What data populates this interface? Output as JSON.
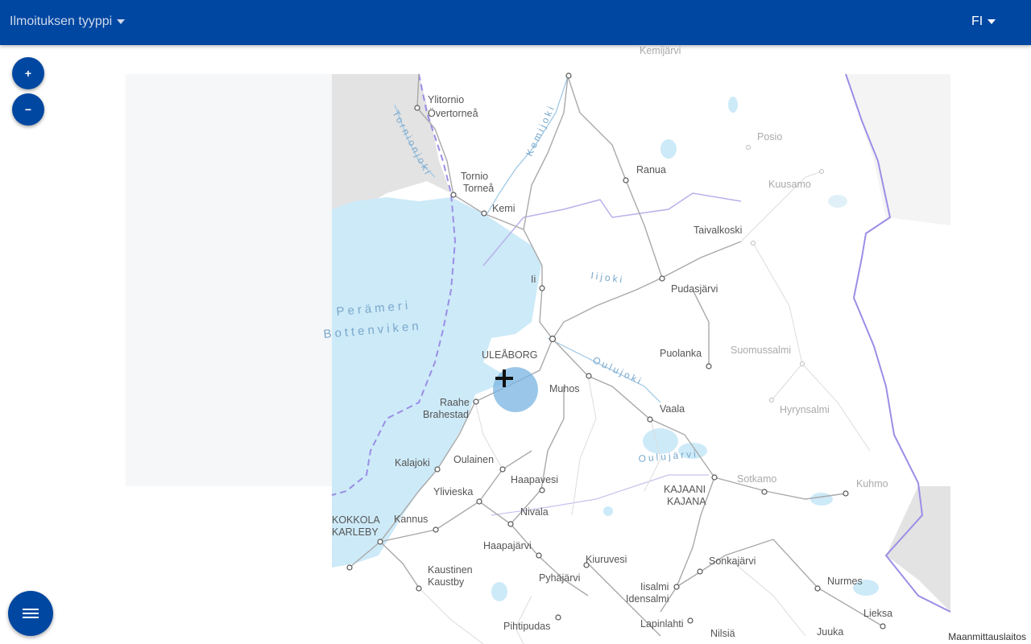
{
  "header": {
    "type_select_label": "Ilmoituksen tyyppi",
    "language": "FI"
  },
  "zoom": {
    "in_label": "+",
    "out_label": "−"
  },
  "map": {
    "attribution": "Maanmittauslaitos",
    "water_labels": [
      "Perämeri",
      "Bottenviken"
    ],
    "river_labels": [
      "Tornionjoki",
      "Kemijoki",
      "Iijoki",
      "Oulujoki",
      "Oulujärvi"
    ],
    "places": [
      {
        "name": "Kemijärvi"
      },
      {
        "name": "Ylitornio"
      },
      {
        "name": "Övertorneå"
      },
      {
        "name": "Tornio"
      },
      {
        "name": "Torneå"
      },
      {
        "name": "Kemi"
      },
      {
        "name": "Ranua"
      },
      {
        "name": "Posio"
      },
      {
        "name": "Kuusamo"
      },
      {
        "name": "Taivalkoski"
      },
      {
        "name": "Ii"
      },
      {
        "name": "Pudasjärvi"
      },
      {
        "name": "Puolanka"
      },
      {
        "name": "Suomussalmi"
      },
      {
        "name": "ULEÅBORG"
      },
      {
        "name": "Muhos"
      },
      {
        "name": "Raahe"
      },
      {
        "name": "Brahestad"
      },
      {
        "name": "Vaala"
      },
      {
        "name": "Hyrynsalmi"
      },
      {
        "name": "Kalajoki"
      },
      {
        "name": "Oulainen"
      },
      {
        "name": "Haapavesi"
      },
      {
        "name": "Sotkamo"
      },
      {
        "name": "Kuhmo"
      },
      {
        "name": "Ylivieska"
      },
      {
        "name": "Nivala"
      },
      {
        "name": "KAJAANI"
      },
      {
        "name": "KAJANA"
      },
      {
        "name": "KOKKOLA"
      },
      {
        "name": "KARLEBY"
      },
      {
        "name": "Kannus"
      },
      {
        "name": "Haapajärvi"
      },
      {
        "name": "Kaustinen"
      },
      {
        "name": "Kaustby"
      },
      {
        "name": "Kiuruvesi"
      },
      {
        "name": "Sonkajärvi"
      },
      {
        "name": "Pyhäjärvi"
      },
      {
        "name": "Iisalmi"
      },
      {
        "name": "Idensalmi"
      },
      {
        "name": "Nurmes"
      },
      {
        "name": "Lieksa"
      },
      {
        "name": "Pihtipudas"
      },
      {
        "name": "Lapinlahti"
      },
      {
        "name": "Nilsiä"
      },
      {
        "name": "Juuka"
      }
    ]
  },
  "colors": {
    "header": "#0047a1",
    "water": "#cdeaf8",
    "border": "#9b8ee6",
    "roads": "#a9a9a9"
  }
}
